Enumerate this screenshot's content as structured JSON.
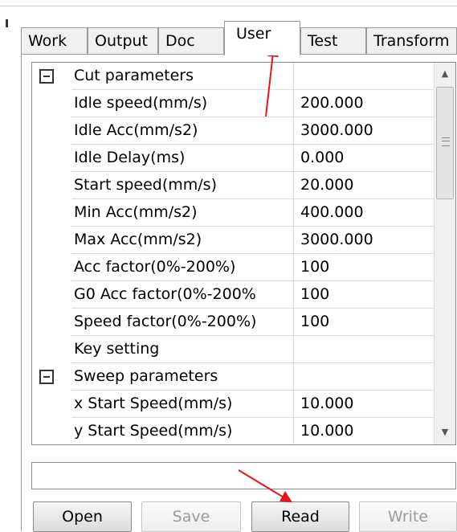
{
  "tabs": [
    {
      "label": "Work"
    },
    {
      "label": "Output"
    },
    {
      "label": "Doc"
    },
    {
      "label": "User"
    },
    {
      "label": "Test"
    },
    {
      "label": "Transform"
    }
  ],
  "active_tab": "User",
  "grid": {
    "rows": [
      {
        "name": "Cut parameters",
        "value": "",
        "group": true
      },
      {
        "name": "Idle speed(mm/s)",
        "value": "200.000"
      },
      {
        "name": "Idle Acc(mm/s2)",
        "value": "3000.000"
      },
      {
        "name": "Idle Delay(ms)",
        "value": "0.000"
      },
      {
        "name": "Start speed(mm/s)",
        "value": "20.000"
      },
      {
        "name": "Min Acc(mm/s2)",
        "value": "400.000"
      },
      {
        "name": "Max Acc(mm/s2)",
        "value": "3000.000"
      },
      {
        "name": "Acc factor(0%-200%)",
        "value": "100"
      },
      {
        "name": "G0 Acc factor(0%-200%",
        "value": "100"
      },
      {
        "name": "Speed factor(0%-200%)",
        "value": "100"
      },
      {
        "name": "Key setting",
        "value": ""
      },
      {
        "name": "Sweep parameters",
        "value": "",
        "group": true
      },
      {
        "name": "x Start Speed(mm/s)",
        "value": "10.000"
      },
      {
        "name": "y Start Speed(mm/s)",
        "value": "10.000"
      }
    ],
    "scroll_up_icon": "triangle-up",
    "scroll_down_icon": "triangle-down"
  },
  "status_text": "",
  "buttons": {
    "open": "Open",
    "save": "Save",
    "read": "Read",
    "write": "Write"
  },
  "annotation_color": "#e8161b"
}
